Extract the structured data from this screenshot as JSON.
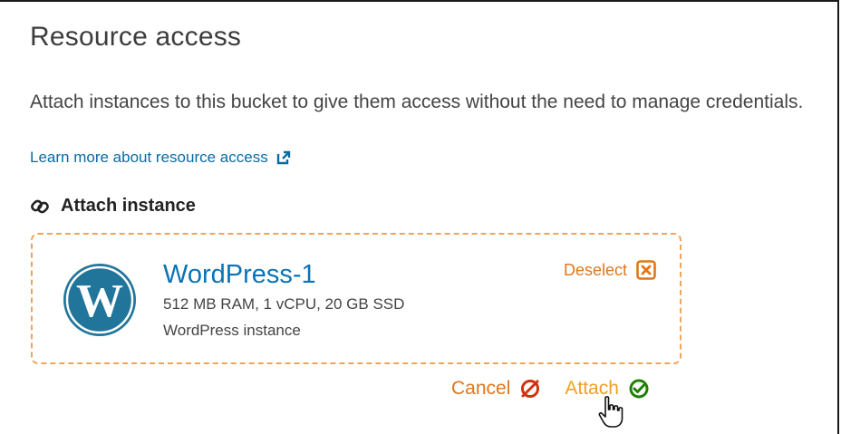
{
  "panel": {
    "title": "Resource access",
    "description": "Attach instances to this bucket to give them access without the need to manage credentials.",
    "learn_more_link": "Learn more about resource access"
  },
  "attach_section": {
    "heading": "Attach instance",
    "icon": "link-icon"
  },
  "instance": {
    "name": "WordPress-1",
    "spec": "512 MB RAM, 1 vCPU, 20 GB SSD",
    "type": "WordPress instance",
    "logo": "wordpress-logo",
    "deselect_label": "Deselect"
  },
  "actions": {
    "cancel_label": "Cancel",
    "attach_label": "Attach"
  },
  "colors": {
    "accent_orange": "#e0761b",
    "link_blue": "#0b6aa2",
    "instance_blue": "#0b73b5",
    "confirm_green": "#1d8102",
    "card_border": "#f0a45a"
  }
}
